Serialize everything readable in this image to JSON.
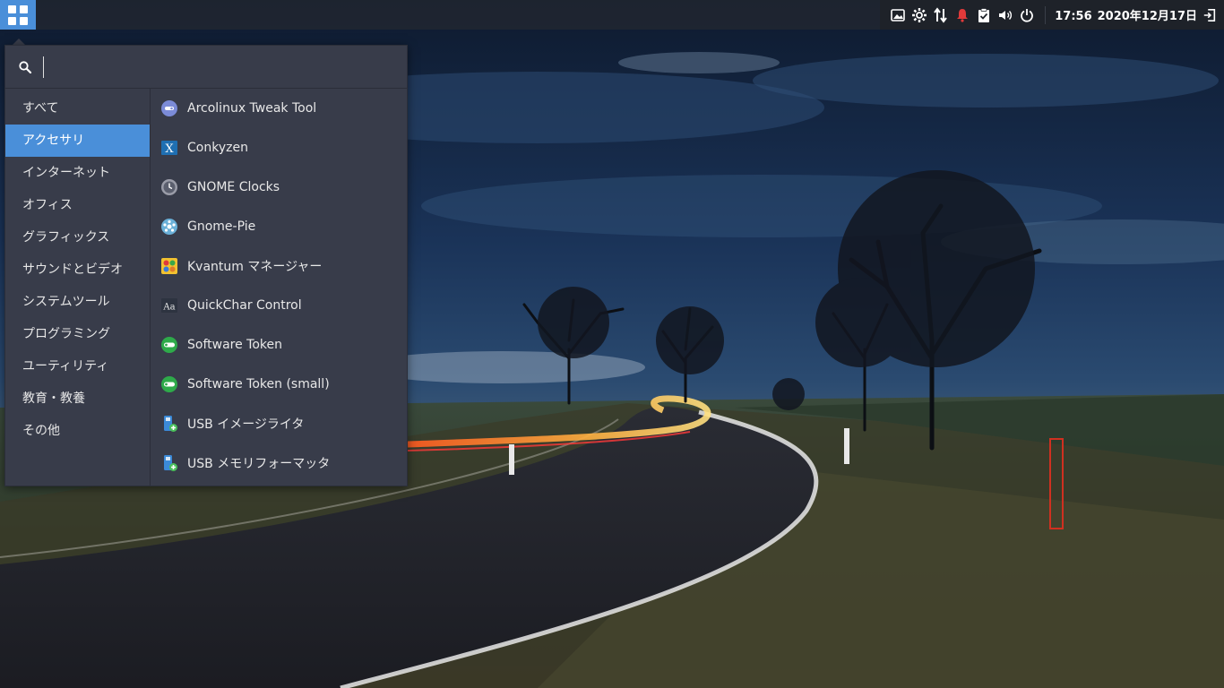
{
  "panel": {
    "menu_button_icon": "applications-grid-icon",
    "tray_icons": [
      "screenshot-icon",
      "settings-gear-icon",
      "network-transfer-icon",
      "notification-bell-icon",
      "clipboard-check-icon",
      "volume-icon",
      "power-icon"
    ],
    "clock": {
      "time": "17:56",
      "date": "2020年12月17日"
    },
    "logout_icon": "logout-icon",
    "accent_color": "#4a8fd9"
  },
  "menu": {
    "search": {
      "value": "",
      "placeholder": ""
    },
    "categories": [
      {
        "label": "すべて",
        "active": false
      },
      {
        "label": "アクセサリ",
        "active": true
      },
      {
        "label": "インターネット",
        "active": false
      },
      {
        "label": "オフィス",
        "active": false
      },
      {
        "label": "グラフィックス",
        "active": false
      },
      {
        "label": "サウンドとビデオ",
        "active": false
      },
      {
        "label": "システムツール",
        "active": false
      },
      {
        "label": "プログラミング",
        "active": false
      },
      {
        "label": "ユーティリティ",
        "active": false
      },
      {
        "label": "教育・教養",
        "active": false
      },
      {
        "label": "その他",
        "active": false
      }
    ],
    "apps": [
      {
        "label": "Arcolinux Tweak Tool",
        "icon": "tweak-tool-icon"
      },
      {
        "label": "Conkyzen",
        "icon": "conkyzen-icon"
      },
      {
        "label": "GNOME Clocks",
        "icon": "clock-icon"
      },
      {
        "label": "Gnome-Pie",
        "icon": "pie-icon"
      },
      {
        "label": "Kvantum マネージャー",
        "icon": "kvantum-icon"
      },
      {
        "label": "QuickChar Control",
        "icon": "quickchar-icon"
      },
      {
        "label": "Software Token",
        "icon": "token-icon"
      },
      {
        "label": "Software Token (small)",
        "icon": "token-small-icon"
      },
      {
        "label": "USB イメージライタ",
        "icon": "usb-writer-icon"
      },
      {
        "label": "USB メモリフォーマッタ",
        "icon": "usb-formatter-icon"
      }
    ]
  }
}
